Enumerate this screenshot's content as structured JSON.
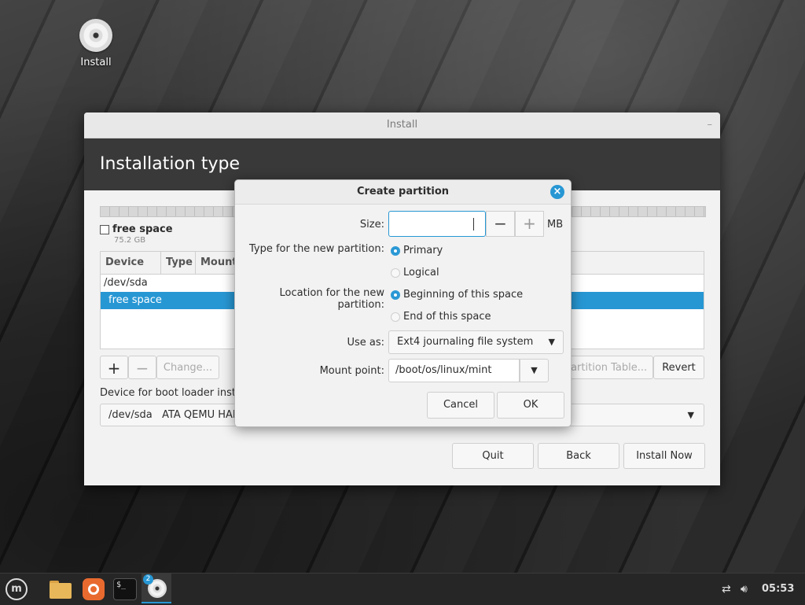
{
  "desktop": {
    "icon_label": "Install"
  },
  "window": {
    "title": "Install",
    "minimize_glyph": "–",
    "heading": "Installation type",
    "legend": {
      "label": "free space",
      "size": "75.2 GB"
    },
    "table": {
      "headers": [
        "Device",
        "Type",
        "Mount"
      ],
      "rows": [
        "/dev/sda",
        "free space"
      ]
    },
    "toolbar": {
      "add": "+",
      "remove": "−",
      "change": "Change...",
      "new_table": "Partition Table...",
      "revert": "Revert"
    },
    "bootloader_label": "Device for boot loader instal",
    "bootloader_device": "/dev/sda   ATA QEMU HAR",
    "buttons": {
      "quit": "Quit",
      "back": "Back",
      "install": "Install Now"
    }
  },
  "dialog": {
    "title": "Create partition",
    "size_label": "Size:",
    "size_value": "",
    "minus": "−",
    "plus": "+",
    "unit": "MB",
    "type_label": "Type for the new partition:",
    "type_options": [
      "Primary",
      "Logical"
    ],
    "type_selected": "Primary",
    "location_label": "Location for the new partition:",
    "location_options": [
      "Beginning of this space",
      "End of this space"
    ],
    "location_selected": "Beginning of this space",
    "use_as_label": "Use as:",
    "use_as_value": "Ext4 journaling file system",
    "mount_label": "Mount point:",
    "mount_value": "/boot/os/linux/mint",
    "cancel": "Cancel",
    "ok": "OK"
  },
  "taskbar": {
    "menu_glyph": "m",
    "terminal_glyph": "$_",
    "install_badge": "2",
    "clock": "05:53"
  },
  "colors": {
    "accent": "#2797d4",
    "banner": "#393939",
    "taskbar": "#262626"
  }
}
